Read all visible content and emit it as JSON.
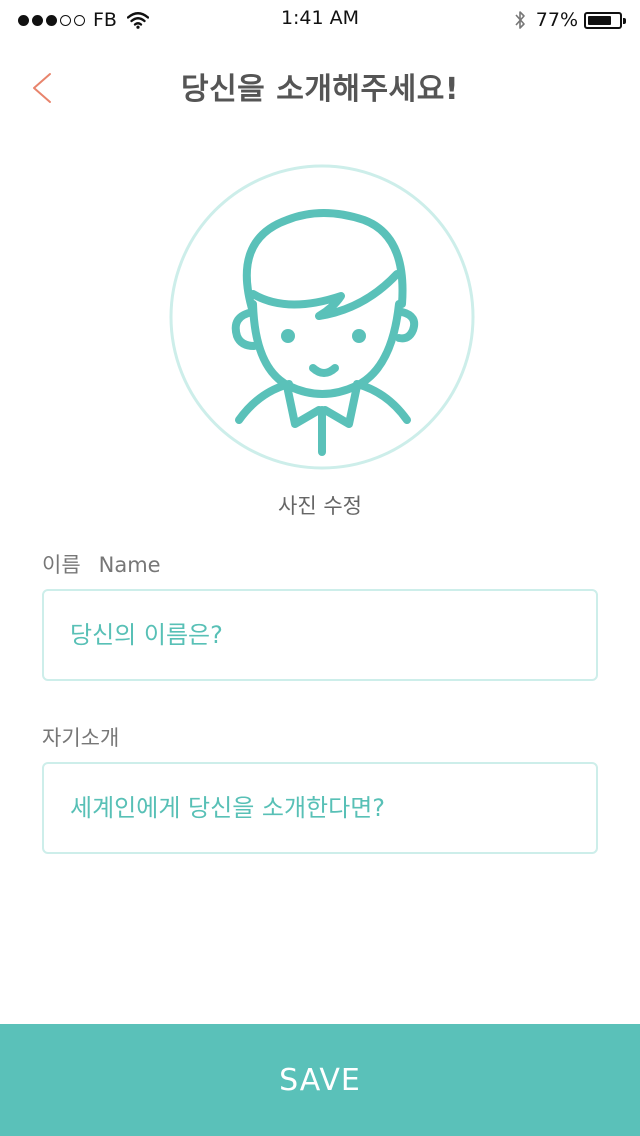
{
  "status_bar": {
    "carrier": "FB",
    "time": "1:41 AM",
    "battery_percent": "77%",
    "battery_level": 0.77,
    "signal_filled": 3,
    "signal_total": 5
  },
  "header": {
    "title": "당신을 소개해주세요!",
    "back_icon": "chevron-left-icon"
  },
  "avatar": {
    "icon": "boy-avatar-icon",
    "edit_label": "사진 수정"
  },
  "form": {
    "name_label_ko": "이름",
    "name_label_en": "Name",
    "name_placeholder": "당신의 이름은?",
    "name_value": "",
    "intro_label": "자기소개",
    "intro_placeholder": "세계인에게 당신을 소개한다면?",
    "intro_value": ""
  },
  "save_label": "SAVE",
  "colors": {
    "accent": "#5ac1b9",
    "back_arrow": "#e8846c",
    "field_border": "#cdeeea",
    "placeholder": "#58c0b6"
  }
}
